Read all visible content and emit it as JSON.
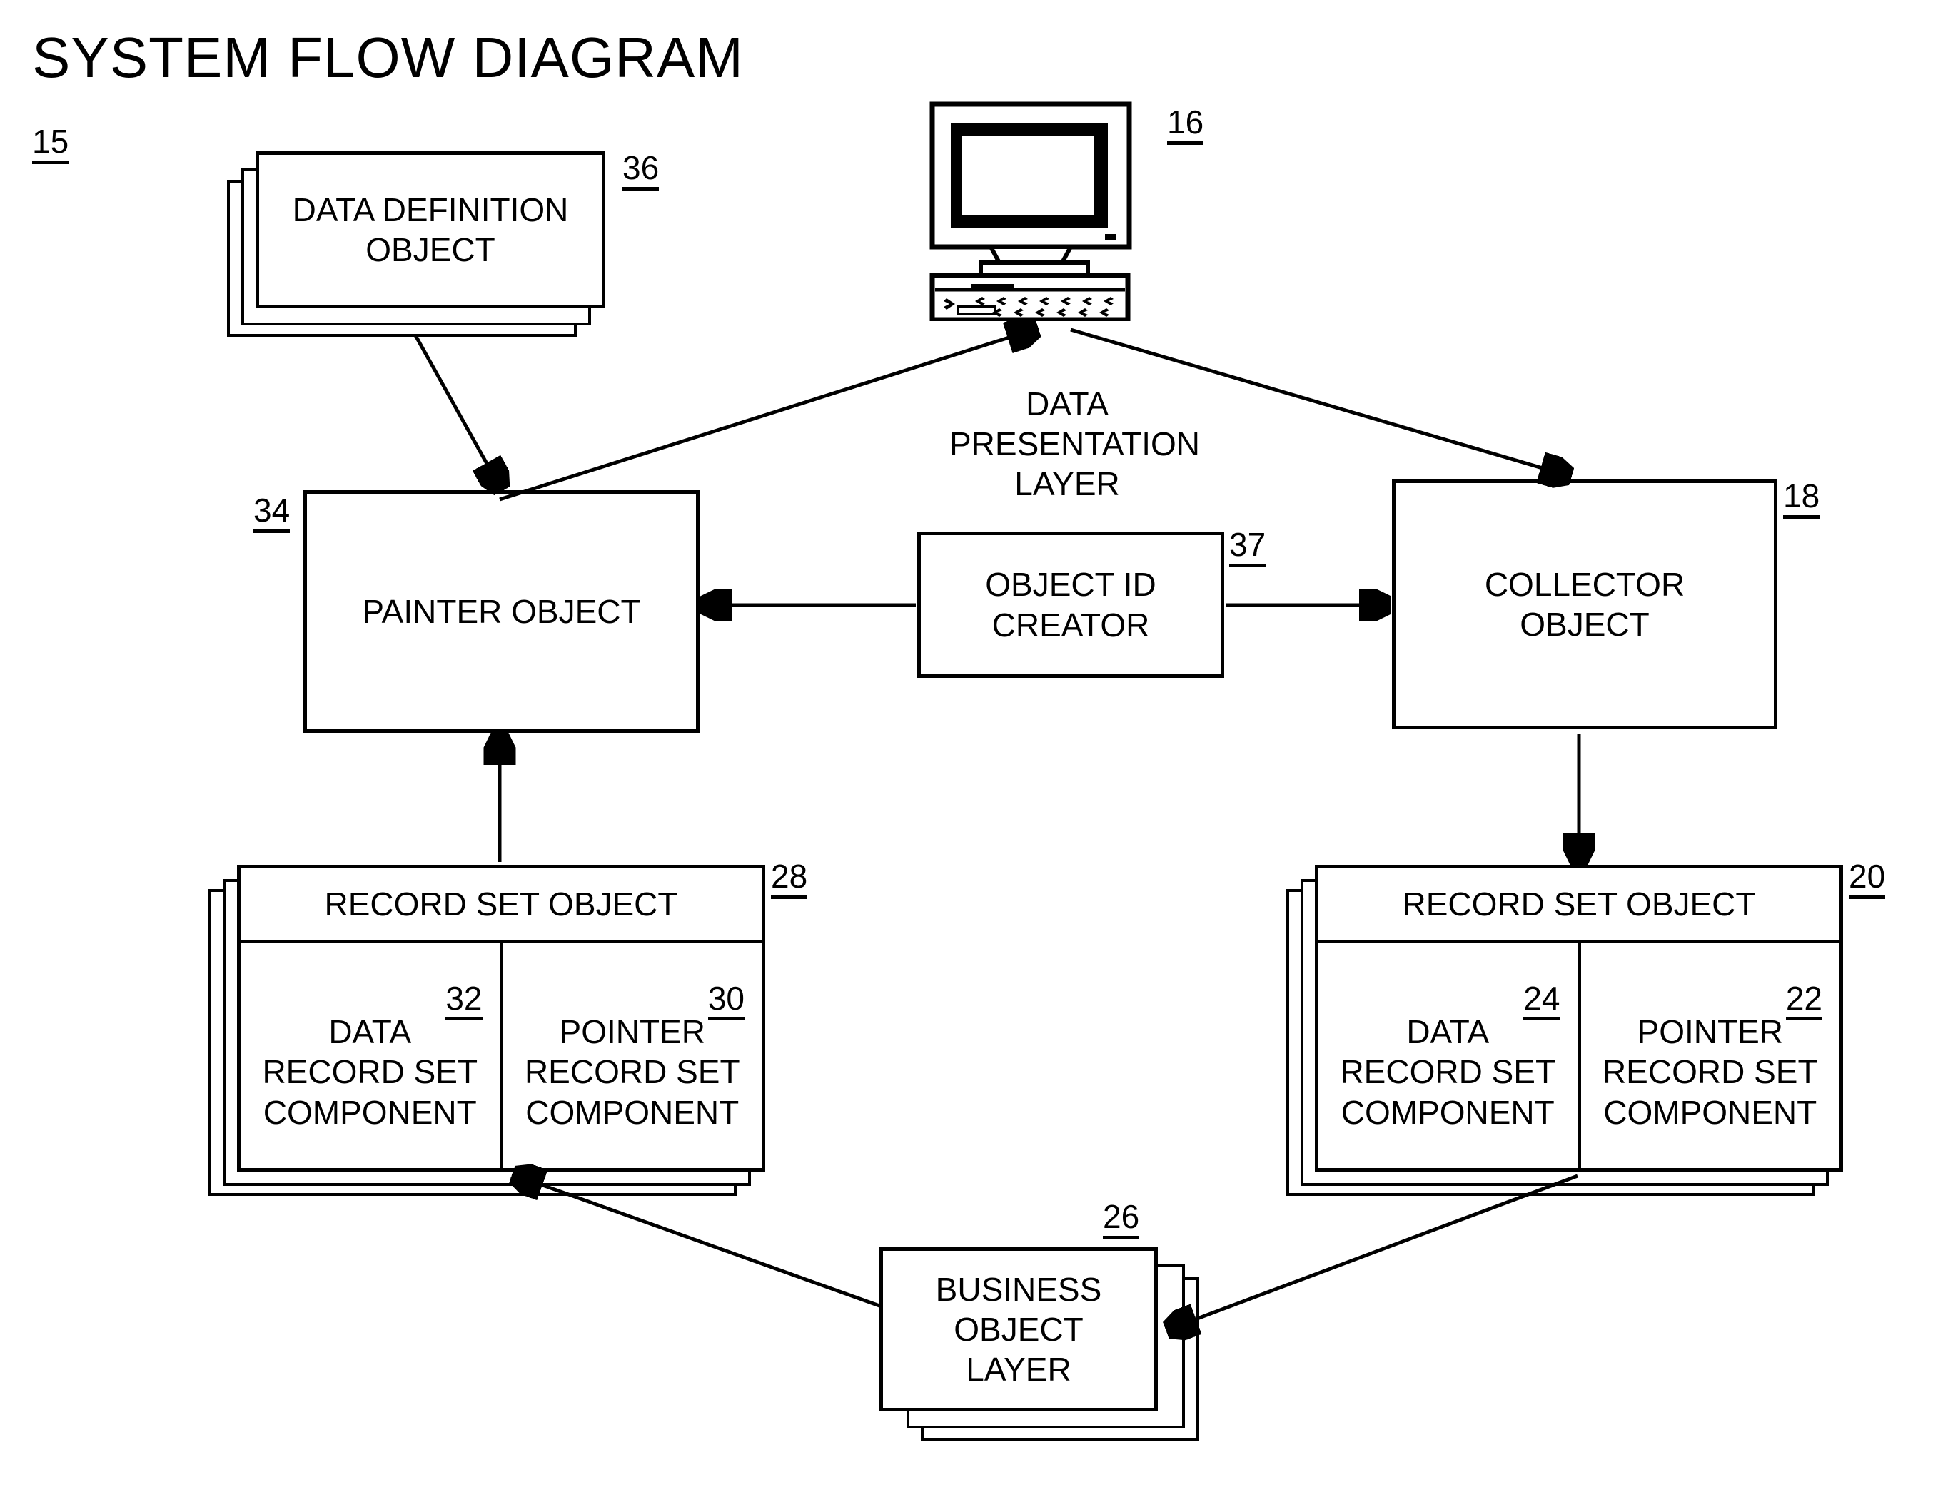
{
  "figure": {
    "title": "SYSTEM FLOW DIAGRAM",
    "figure_ref": "15"
  },
  "refs": {
    "figure": "15",
    "monitor": "16",
    "data_definition_object": "36",
    "painter_object": "34",
    "object_id_creator": "37",
    "collector_object": "18",
    "record_set_object_left": "28",
    "data_record_set_component_left": "32",
    "pointer_record_set_component_left": "30",
    "record_set_object_right": "20",
    "data_record_set_component_right": "24",
    "pointer_record_set_component_right": "22",
    "business_object_layer": "26"
  },
  "nodes": {
    "data_definition_object": {
      "label": "DATA DEFINITION\nOBJECT",
      "ref": "36"
    },
    "monitor": {
      "icon": "crt-monitor-icon",
      "ref": "16"
    },
    "data_presentation_layer": {
      "label": "DATA\nPRESENTATION\nLAYER"
    },
    "painter_object": {
      "label": "PAINTER OBJECT",
      "ref": "34"
    },
    "object_id_creator": {
      "label": "OBJECT ID\nCREATOR",
      "ref": "37"
    },
    "collector_object": {
      "label": "COLLECTOR\nOBJECT",
      "ref": "18"
    },
    "record_set_object_left": {
      "header": "RECORD SET OBJECT",
      "ref": "28",
      "cells": [
        {
          "label": "DATA\nRECORD SET\nCOMPONENT",
          "ref": "32"
        },
        {
          "label": "POINTER\nRECORD SET\nCOMPONENT",
          "ref": "30"
        }
      ]
    },
    "record_set_object_right": {
      "header": "RECORD SET OBJECT",
      "ref": "20",
      "cells": [
        {
          "label": "DATA\nRECORD SET\nCOMPONENT",
          "ref": "24"
        },
        {
          "label": "POINTER\nRECORD SET\nCOMPONENT",
          "ref": "22"
        }
      ]
    },
    "business_object_layer": {
      "label": "BUSINESS\nOBJECT\nLAYER",
      "ref": "26"
    }
  },
  "edges": [
    {
      "from": "data_definition_object",
      "to": "painter_object",
      "arrow": "single"
    },
    {
      "from": "painter_object",
      "to": "monitor",
      "arrow": "single"
    },
    {
      "from": "monitor",
      "to": "collector_object",
      "arrow": "single"
    },
    {
      "from": "object_id_creator",
      "to": "painter_object",
      "arrow": "single"
    },
    {
      "from": "object_id_creator",
      "to": "collector_object",
      "arrow": "single"
    },
    {
      "from": "record_set_object_left",
      "to": "painter_object",
      "arrow": "single"
    },
    {
      "from": "collector_object",
      "to": "record_set_object_right",
      "arrow": "single"
    },
    {
      "from": "business_object_layer",
      "to": "record_set_object_left",
      "arrow": "single"
    },
    {
      "from": "record_set_object_right",
      "to": "business_object_layer",
      "arrow": "single"
    }
  ],
  "colors": {
    "ink": "#000000",
    "paper": "#ffffff"
  }
}
